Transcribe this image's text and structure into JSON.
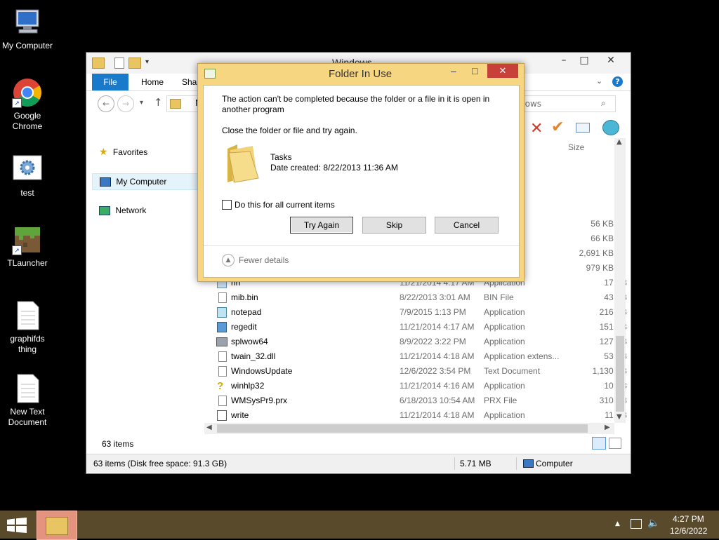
{
  "desktop": {
    "icons": [
      {
        "label": "My Computer",
        "icon": "computer-icon"
      },
      {
        "label": "Google Chrome",
        "icon": "chrome-icon"
      },
      {
        "label": "test",
        "icon": "settings-file-icon"
      },
      {
        "label": "TLauncher",
        "icon": "minecraft-icon"
      },
      {
        "label": "graphifds thing",
        "icon": "text-file-icon"
      },
      {
        "label": "New Text Document",
        "icon": "text-file-icon"
      }
    ]
  },
  "explorer": {
    "title": "Windows",
    "ribbon_tabs": {
      "file": "File",
      "home": "Home",
      "share": "Shar"
    },
    "address_fragment": "M",
    "search_fragment": "dows",
    "size_header": "Size",
    "sidebar": {
      "favorites": "Favorites",
      "my_computer": "My Computer",
      "network": "Network"
    },
    "partial_rows": [
      {
        "type": "n",
        "size": "56 KB"
      },
      {
        "type": "",
        "size": "66 KB"
      },
      {
        "type": "n",
        "size": "2,691 KB"
      },
      {
        "type": "n",
        "size": "979 KB"
      }
    ],
    "files": [
      {
        "name": "hh",
        "date": "11/21/2014 4:17 AM",
        "type": "Application",
        "size": "17 KB",
        "icon": "app-icon"
      },
      {
        "name": "mib.bin",
        "date": "8/22/2013 3:01 AM",
        "type": "BIN File",
        "size": "43 KB",
        "icon": "file-icon"
      },
      {
        "name": "notepad",
        "date": "7/9/2015 1:13 PM",
        "type": "Application",
        "size": "216 KB",
        "icon": "notepad-icon"
      },
      {
        "name": "regedit",
        "date": "11/21/2014 4:17 AM",
        "type": "Application",
        "size": "151 KB",
        "icon": "regedit-icon"
      },
      {
        "name": "splwow64",
        "date": "8/9/2022 3:22 PM",
        "type": "Application",
        "size": "127 KB",
        "icon": "printer-icon"
      },
      {
        "name": "twain_32.dll",
        "date": "11/21/2014 4:18 AM",
        "type": "Application extens...",
        "size": "53 KB",
        "icon": "dll-icon"
      },
      {
        "name": "WindowsUpdate",
        "date": "12/6/2022 3:54 PM",
        "type": "Text Document",
        "size": "1,130 KB",
        "icon": "text-file-icon"
      },
      {
        "name": "winhlp32",
        "date": "11/21/2014 4:16 AM",
        "type": "Application",
        "size": "10 KB",
        "icon": "help-icon"
      },
      {
        "name": "WMSysPr9.prx",
        "date": "6/18/2013 10:54 AM",
        "type": "PRX File",
        "size": "310 KB",
        "icon": "file-icon"
      },
      {
        "name": "write",
        "date": "11/21/2014 4:18 AM",
        "type": "Application",
        "size": "11 KB",
        "icon": "write-icon"
      }
    ],
    "item_count": "63 items",
    "status": {
      "left": "63 items (Disk free space: 91.3 GB)",
      "size": "5.71 MB",
      "location": "Computer"
    }
  },
  "dialog": {
    "title": "Folder In Use",
    "message": "The action can't be completed because the folder or a file in it is open in another program",
    "instruction": "Close the folder or file and try again.",
    "item_name": "Tasks",
    "item_date": "Date created: 8/22/2013 11:36 AM",
    "checkbox_label": "Do this for all current items",
    "buttons": {
      "try_again": "Try Again",
      "skip": "Skip",
      "cancel": "Cancel"
    },
    "fewer_details": "Fewer details"
  },
  "taskbar": {
    "time": "4:27 PM",
    "date": "12/6/2022"
  },
  "colors": {
    "dialog_frame": "#f7d682",
    "close_red": "#c7413a",
    "ribbon_blue": "#1979ca",
    "taskbar": "#5a4a2c"
  }
}
